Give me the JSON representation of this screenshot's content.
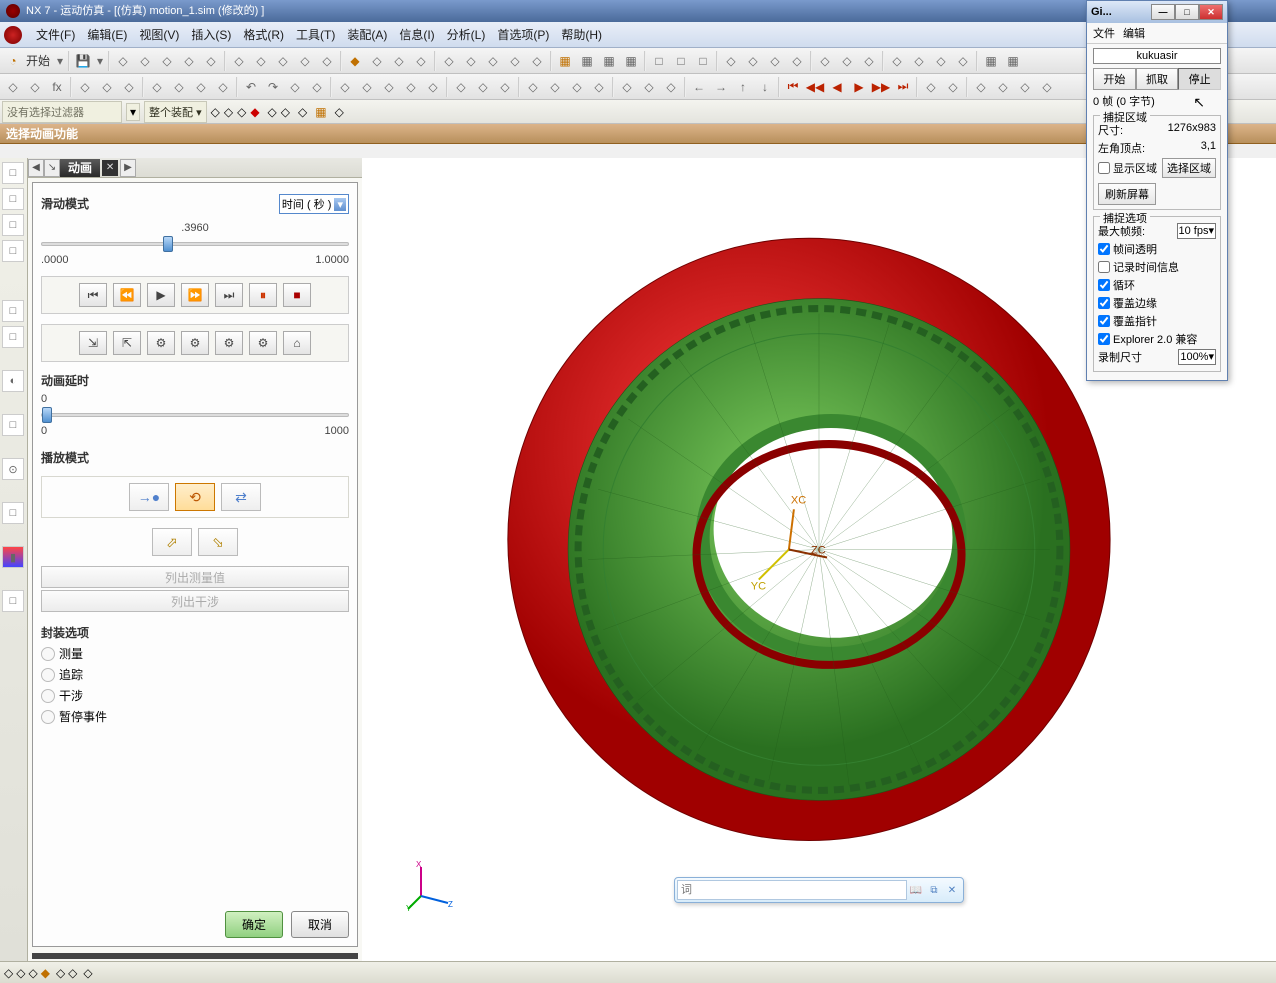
{
  "title": "NX 7 - 运动仿真 - [(仿真) motion_1.sim (修改的) ]",
  "menu": {
    "file": "文件(F)",
    "edit": "编辑(E)",
    "view": "视图(V)",
    "insert": "插入(S)",
    "format": "格式(R)",
    "tools": "工具(T)",
    "assembly": "装配(A)",
    "info": "信息(I)",
    "analysis": "分析(L)",
    "preferences": "首选项(P)",
    "help": "帮助(H)"
  },
  "toolbar": {
    "start": "开始"
  },
  "selection": {
    "no_filter": "没有选择过滤器",
    "whole_assembly": "整个装配"
  },
  "page_label": "选择动画功能",
  "anim": {
    "tab": "动画",
    "slide_mode": "滑动模式",
    "time_sec": "时间 ( 秒 )",
    "slider_value": ".3960",
    "slider_min": ".0000",
    "slider_max": "1.0000",
    "delay_label": "动画延时",
    "delay_value": "0",
    "delay_min": "0",
    "delay_max": "1000",
    "play_mode": "播放模式",
    "list_measure": "列出测量值",
    "list_interf": "列出干涉",
    "pack_opts": "封装选项",
    "measure": "测量",
    "trace": "追踪",
    "interference": "干涉",
    "pause_event": "暂停事件",
    "ok": "确定",
    "cancel": "取消"
  },
  "gif": {
    "title": "Gi...",
    "menu_file": "文件",
    "menu_edit": "编辑",
    "name": "kukuasir",
    "start": "开始",
    "grab": "抓取",
    "stop": "停止",
    "frames": "0 帧 (0 字节)",
    "capture_area": "捕捉区域",
    "size_lbl": "尺寸:",
    "size_val": "1276x983",
    "topleft_lbl": "左角顶点:",
    "topleft_val": "3,1",
    "show_area": "显示区域",
    "select_area": "选择区域",
    "refresh": "刷新屏幕",
    "capture_opts": "捕捉选项",
    "max_fps_lbl": "最大帧频:",
    "max_fps_val": "10 fps",
    "interframe_transp": "帧间透明",
    "record_time": "记录时间信息",
    "loop": "循环",
    "cover_edges": "覆盖边缘",
    "cover_cursor": "覆盖指针",
    "explorer_compat": "Explorer 2.0 兼容",
    "record_size_lbl": "录制尺寸",
    "record_size_val": "100%"
  },
  "search_placeholder": "词",
  "triad": {
    "x": "X",
    "y": "Y",
    "z": "Z"
  },
  "coord": {
    "xc": "XC",
    "yc": "YC",
    "zc": "ZC"
  }
}
